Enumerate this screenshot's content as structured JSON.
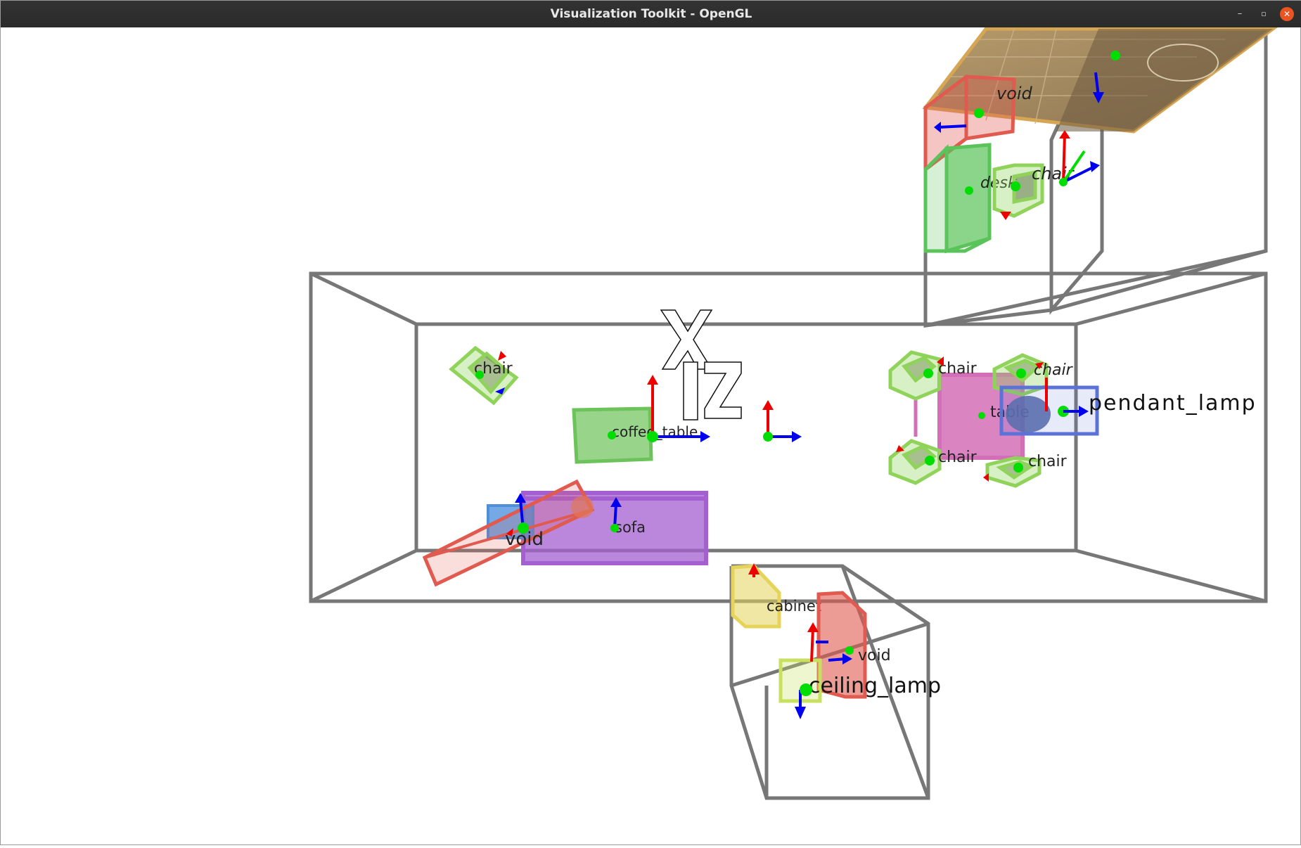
{
  "window": {
    "title": "Visualization Toolkit - OpenGL",
    "controls": {
      "minimize": "–",
      "maximize": "▫",
      "close": "✕"
    }
  },
  "scene": {
    "labels": {
      "void_top": "void",
      "desk": "desk",
      "chair_top": "chair",
      "chair_left": "chair",
      "coffee_table": "coffee_table",
      "chair_r1": "chair",
      "chair_r2": "chair",
      "chair_r3": "chair",
      "chair_r4": "chair",
      "table": "table",
      "pendant_lamp": "pendant_lamp",
      "void_sofa": "void",
      "sofa": "sofa",
      "cabinet": "cabinet",
      "void_bottom": "void",
      "ceiling_lamp": "ceiling_lamp"
    },
    "colors": {
      "room_wireframe": "#777777",
      "chair": "#8fd35a",
      "desk": "#5ac35a",
      "void": "#e05a4f",
      "sofa": "#a45fd1",
      "table": "#d36fb7",
      "pendant_lamp": "#5b72d6",
      "cabinet": "#e6d35a",
      "coffee_table": "#6cc35a",
      "axis_x": "#ee0000",
      "axis_y": "#0000ee",
      "axis_z": "#00dd00"
    }
  }
}
